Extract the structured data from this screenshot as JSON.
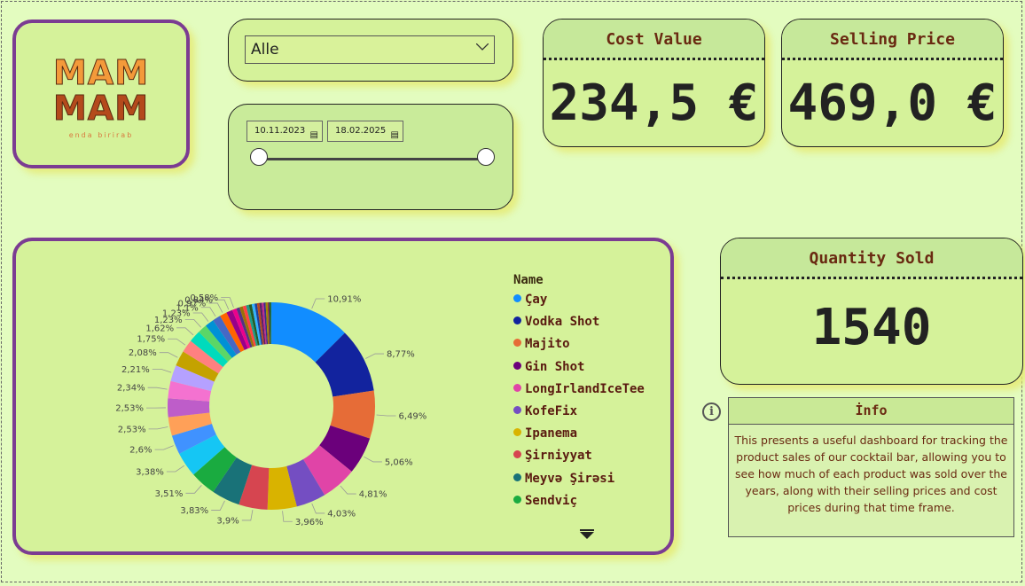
{
  "logo": {
    "line1": "MAM",
    "line2": "MAM",
    "tagline": "enda birirab"
  },
  "filter": {
    "selected": "Alle"
  },
  "date_range": {
    "start": "10.11.2023",
    "end": "18.02.2025",
    "slider_start": 0,
    "slider_end": 1
  },
  "kpis": {
    "cost": {
      "label": "Cost Value",
      "value": "234,5 €"
    },
    "selling": {
      "label": "Selling Price",
      "value": "469,0 €"
    },
    "quantity": {
      "label": "Quantity Sold",
      "value": "1540"
    }
  },
  "info": {
    "title": "İnfo",
    "text": "This presents a useful dashboard for tracking the product sales of our cocktail bar, allowing you to see how much of each product was sold over the years, along with their selling prices and cost prices during that time frame."
  },
  "chart_data": {
    "type": "pie",
    "donut": true,
    "legend_title": "Name",
    "legend_position": "right",
    "categories": [
      "Çay",
      "Vodka Shot",
      "Majito",
      "Gin Shot",
      "LongIrlandIceTee",
      "KofeFix",
      "Ipanema",
      "Şirniyyat",
      "Meyvə Şirəsi",
      "Sendviç"
    ],
    "values": [
      10.91,
      8.77,
      6.49,
      5.06,
      4.81,
      4.03,
      3.96,
      3.9,
      3.83,
      3.51,
      3.38,
      2.6,
      2.53,
      2.53,
      2.34,
      2.21,
      2.08,
      1.75,
      1.62,
      1.23,
      1.23,
      1.1,
      0.97,
      0.84,
      0.58,
      0.45,
      0.45,
      0.45,
      0.39,
      0.39,
      0.39,
      0.32,
      0.32,
      0.32,
      0.26,
      0.26,
      0.26,
      0.19,
      0.19,
      0.13
    ],
    "labels": [
      "10,91%",
      "8,77%",
      "6,49%",
      "5,06%",
      "4,81%",
      "4,03%",
      "3,96%",
      "3,9%",
      "3,83%",
      "3,51%",
      "3,38%",
      "2,6%",
      "2,53%",
      "2,53%",
      "2,34%",
      "2,21%",
      "2,08%",
      "1,75%",
      "1,62%",
      "1,23%",
      "1,23%",
      "1,1%",
      "0,97%",
      "0,84%",
      "0,58%"
    ],
    "colors": [
      "#118dff",
      "#12239e",
      "#e66c37",
      "#6b007b",
      "#e044a7",
      "#744ec2",
      "#d9b300",
      "#d64550",
      "#197278",
      "#1aab40",
      "#15c6f4",
      "#4092ff",
      "#ffa058",
      "#be5dc9",
      "#f472d0",
      "#b5a1ff",
      "#c4a200",
      "#ff8080",
      "#00dbbc",
      "#5bd667",
      "#0091d5",
      "#4668c5",
      "#ff6300",
      "#99008a",
      "#ec008c",
      "#533285",
      "#99700a",
      "#ff4141",
      "#1f9a85",
      "#255a26",
      "#33b1ff",
      "#203f9a",
      "#b54a1f",
      "#5c1e6b",
      "#c2288f",
      "#3b2a8a",
      "#9c8700",
      "#a03040",
      "#0e4a50",
      "#2c7a33"
    ]
  }
}
